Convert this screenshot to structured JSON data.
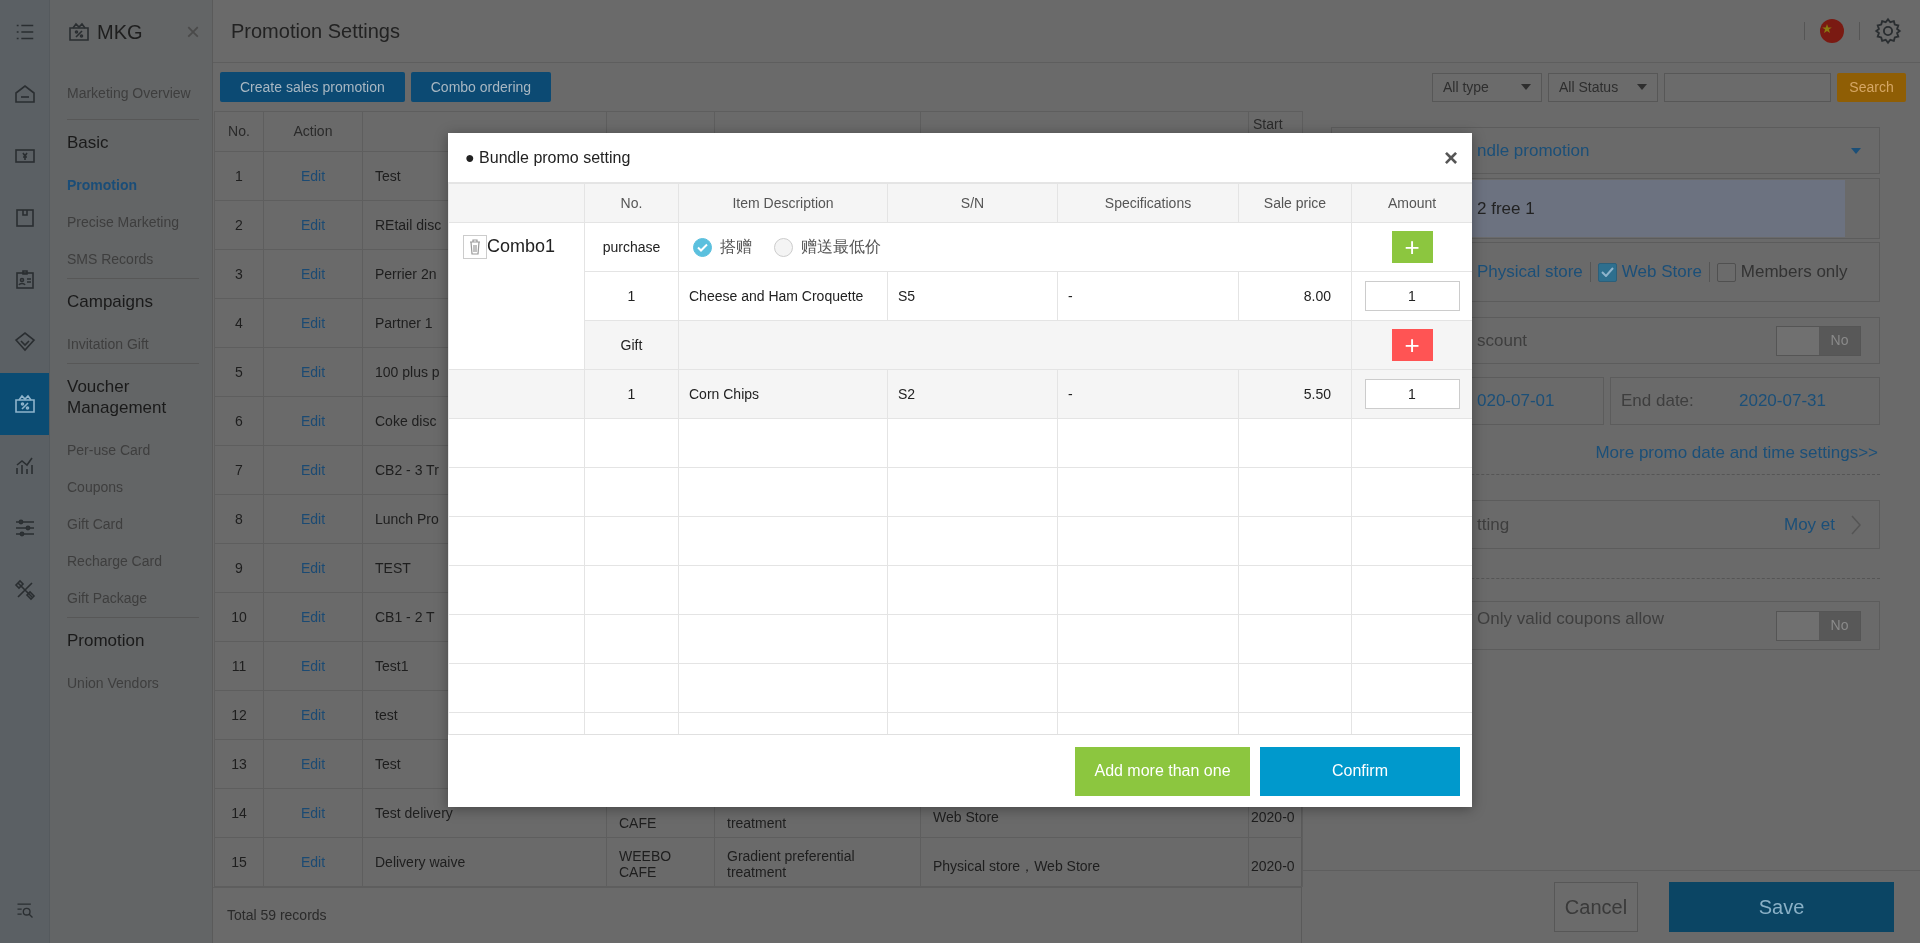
{
  "rail": {
    "items": [
      {
        "selected": false
      },
      {
        "selected": false
      },
      {
        "selected": false
      },
      {
        "selected": false
      },
      {
        "selected": false
      },
      {
        "selected": true
      },
      {
        "selected": false
      },
      {
        "selected": false
      },
      {
        "selected": false
      }
    ]
  },
  "sidebar": {
    "title": "MKG",
    "close": "×",
    "items": [
      {
        "kind": "link",
        "label": "Marketing Overview",
        "selected": false
      },
      {
        "kind": "heading",
        "label": "Basic"
      },
      {
        "kind": "link",
        "label": "Promotion",
        "selected": true
      },
      {
        "kind": "link",
        "label": "Precise Marketing",
        "selected": false
      },
      {
        "kind": "link",
        "label": "SMS Records",
        "selected": false
      },
      {
        "kind": "heading",
        "label": "Campaigns"
      },
      {
        "kind": "link",
        "label": "Invitation Gift",
        "selected": false
      },
      {
        "kind": "heading",
        "label": "Voucher Management"
      },
      {
        "kind": "link",
        "label": "Per-use Card",
        "selected": false
      },
      {
        "kind": "link",
        "label": "Coupons",
        "selected": false
      },
      {
        "kind": "link",
        "label": "Gift Card",
        "selected": false
      },
      {
        "kind": "link",
        "label": "Recharge Card",
        "selected": false
      },
      {
        "kind": "link",
        "label": "Gift Package",
        "selected": false
      },
      {
        "kind": "heading",
        "label": "Promotion"
      },
      {
        "kind": "link",
        "label": "Union Vendors",
        "selected": false
      }
    ]
  },
  "header": {
    "title": "Promotion Settings"
  },
  "toolbar": {
    "buttons": [
      "Create sales promotion",
      "Combo ordering"
    ],
    "filters": [
      "All type",
      "All Status"
    ],
    "search_button": "Search"
  },
  "table": {
    "columns": [
      "No.",
      "Action"
    ],
    "last_column": "Start",
    "rows": [
      {
        "no": "1",
        "action": "Edit",
        "promotion": "Test"
      },
      {
        "no": "2",
        "action": "Edit",
        "promotion": "REtail disc"
      },
      {
        "no": "3",
        "action": "Edit",
        "promotion": "Perrier 2n"
      },
      {
        "no": "4",
        "action": "Edit",
        "promotion": "Partner 1"
      },
      {
        "no": "5",
        "action": "Edit",
        "promotion": "100 plus p"
      },
      {
        "no": "6",
        "action": "Edit",
        "promotion": "Coke disc"
      },
      {
        "no": "7",
        "action": "Edit",
        "promotion": "CB2 - 3 Tr"
      },
      {
        "no": "8",
        "action": "Edit",
        "promotion": "Lunch Pro"
      },
      {
        "no": "9",
        "action": "Edit",
        "promotion": "TEST"
      },
      {
        "no": "10",
        "action": "Edit",
        "promotion": "CB1 - 2 T"
      },
      {
        "no": "11",
        "action": "Edit",
        "promotion": "Test1"
      },
      {
        "no": "12",
        "action": "Edit",
        "promotion": "test"
      },
      {
        "no": "13",
        "action": "Edit",
        "promotion": "Test"
      },
      {
        "no": "14",
        "action": "Edit",
        "promotion": "Test delivery",
        "outlets": "CAFE",
        "promo_type": "treatment",
        "use_within": "Web Store",
        "start": "2020-0"
      },
      {
        "no": "15",
        "action": "Edit",
        "promotion": "Delivery waive",
        "outlets": "WEEBO CAFE",
        "promo_type": "Gradient preferential treatment",
        "use_within": "Physical store，Web Store",
        "start": "2020-0"
      }
    ],
    "footer": "Total 59 records"
  },
  "panel": {
    "type_select": "ndle promotion",
    "name_field": "2 free 1",
    "outlet_label": "Physical store",
    "options": [
      {
        "label": "Web Store",
        "checked": true
      },
      {
        "label": "Members only",
        "checked": false
      }
    ],
    "discount": {
      "label": "scount",
      "on": false,
      "state_text": "No"
    },
    "dates": {
      "start": "020-07-01",
      "end_label": "End date:",
      "end": "2020-07-31"
    },
    "more_link": "More promo date and time settings>>",
    "setting": {
      "label": "tting",
      "value": "Moy et"
    },
    "coupons": {
      "label": "Only valid coupons allow",
      "on": false,
      "state_text": "No"
    },
    "buttons": [
      {
        "label": "Cancel",
        "kind": "secondary"
      },
      {
        "label": "Save",
        "kind": "primary"
      }
    ]
  },
  "modal": {
    "title": "● Bundle promo setting",
    "close": "×",
    "columns": [
      "No.",
      "Item Description",
      "S/N",
      "Specifications",
      "Sale price",
      "Amount"
    ],
    "combos": [
      {
        "name": "Combo1",
        "purchase": {
          "label": "purchase",
          "add": "+",
          "options": [
            {
              "label": "搭赠",
              "selected": true
            },
            {
              "label": "赠送最低价",
              "selected": false
            }
          ],
          "items": [
            {
              "no": "1",
              "description": "Cheese and Ham Croquette",
              "sn": "S5",
              "spec": "-",
              "price": "8.00",
              "amount": "1"
            }
          ]
        },
        "gift": {
          "label": "Gift",
          "add": "+",
          "items": [
            {
              "no": "1",
              "description": "Corn Chips",
              "sn": "S2",
              "spec": "-",
              "price": "5.50",
              "amount": "1"
            }
          ]
        }
      }
    ],
    "buttons": [
      {
        "label": "Add more than one",
        "kind": "secondary"
      },
      {
        "label": "Confirm",
        "kind": "primary"
      }
    ]
  }
}
